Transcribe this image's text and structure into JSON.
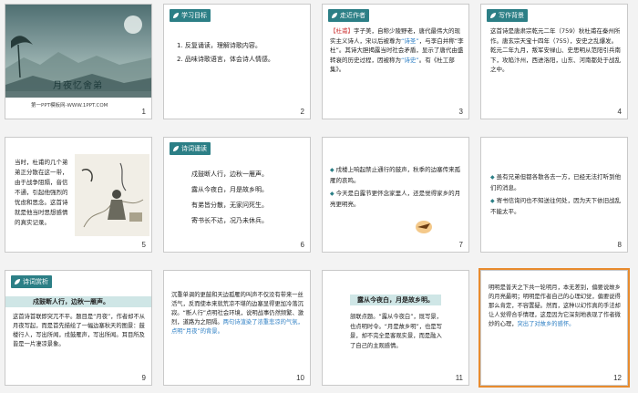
{
  "slides": [
    {
      "num": "1",
      "title": "月夜忆舍弟",
      "footer": "第一PPT模板网-WWW.1PPT.COM"
    },
    {
      "num": "2",
      "tag": "学习目标",
      "lines": [
        "1. 反复诵读，理解诗歌内容。",
        "2. 品味诗歌语言，体会诗人情感。"
      ]
    },
    {
      "num": "3",
      "tag": "走近作者",
      "text_a": "【杜甫】",
      "text_b": "字子美，自称少陵野老，唐代最伟大的现实主义诗人，宋以后被尊为",
      "text_c": "“诗圣”",
      "text_d": "，与李白并称“李杜”。其诗大胆揭露当时社会矛盾，显示了唐代由盛转衰的历史过程，因被称为",
      "text_e": "“诗史”",
      "text_f": "。有《杜工部集》。"
    },
    {
      "num": "4",
      "tag": "写作背景",
      "text": "这首诗是唐肃宗乾元二年（759）秋杜甫在秦州所作。唐玄宗天宝十四年（755），安史之乱爆发。乾元二年九月，叛军安禄山、史思明从范阳引兵南下，攻陷汴州，西进洛阳，山东、河南都处于战乱之中。"
    },
    {
      "num": "5",
      "text": "当时，杜甫的几个弟弟正分散在这一带，由于战争阻隔，音信不通，引起他强烈的忧虑和思念。这首诗就是他当时思想感情的真实记录。"
    },
    {
      "num": "6",
      "tag": "诗词诵读",
      "lines": [
        "戍鼓断人行，边秋一雁声。",
        "露从今夜白，月是故乡明。",
        "有弟皆分散，无家问死生。",
        "寄书长不达，况乃未休兵。"
      ]
    },
    {
      "num": "7",
      "lines": [
        "戍楼上响起禁止通行的鼓声，秋季的边塞传来孤雁的哀鸣。",
        "今天是白露节更怀念家里人，还是觉得家乡的月亮更明亮。"
      ]
    },
    {
      "num": "8",
      "lines": [
        "虽有兄弟但都各散各去一方，已经无法打听到他们的消息。",
        "寄书信询问也不知送往何处，因为天下依旧战乱不能太平。"
      ]
    },
    {
      "num": "9",
      "tag": "诗词赏析",
      "heading": "戍鼓断人行，边秋一雁声。",
      "text": "这首诗首联即突兀不平。题目是“月夜”，作者却不从月夜写起，而是首先描绘了一幅边塞秋天的图景：鼓楼行人，写出所闻，戍鼓雁声，写出所闻。耳目所及皆是一片凄凉景象。"
    },
    {
      "num": "10",
      "text_a": "沉重单调的更鼓和天边孤雁的叫声不仅没有带来一丝活气，反而使本来就荒凉不堪的边塞显得更加冷落沉寂。“断人行”点明社会环境，说明战事仍然频繁、激烈，道路为之阻隔。",
      "text_b": "两句诗渲染了浓重悲凉的气氛，点明“月夜”的背景。"
    },
    {
      "num": "11",
      "heading": "露从今夜白，月是故乡明。",
      "text": "颔联点题。“露从今夜白”，既写景，也点明时令。“月是故乡明”，也是写景，却不完全是客观实景，而是融入了自己的主观感情。"
    },
    {
      "num": "12",
      "text_a": "明明是普天之下共一轮明月，本无差别，偏要说故乡的月亮最明；明明是作者自己的心理幻觉，偏要说得那么肯定，不容置疑。然而，这种以幻作真的手法却让人觉得合乎情理，这是因为它深刻地表现了作者微妙的心理，",
      "text_b": "突出了对故乡的感怀。"
    }
  ],
  "colors": {
    "tag": "#2c7f86",
    "accent_blue": "#2e7fc4",
    "accent_red": "#cc3333",
    "selection": "#e88b2e"
  }
}
